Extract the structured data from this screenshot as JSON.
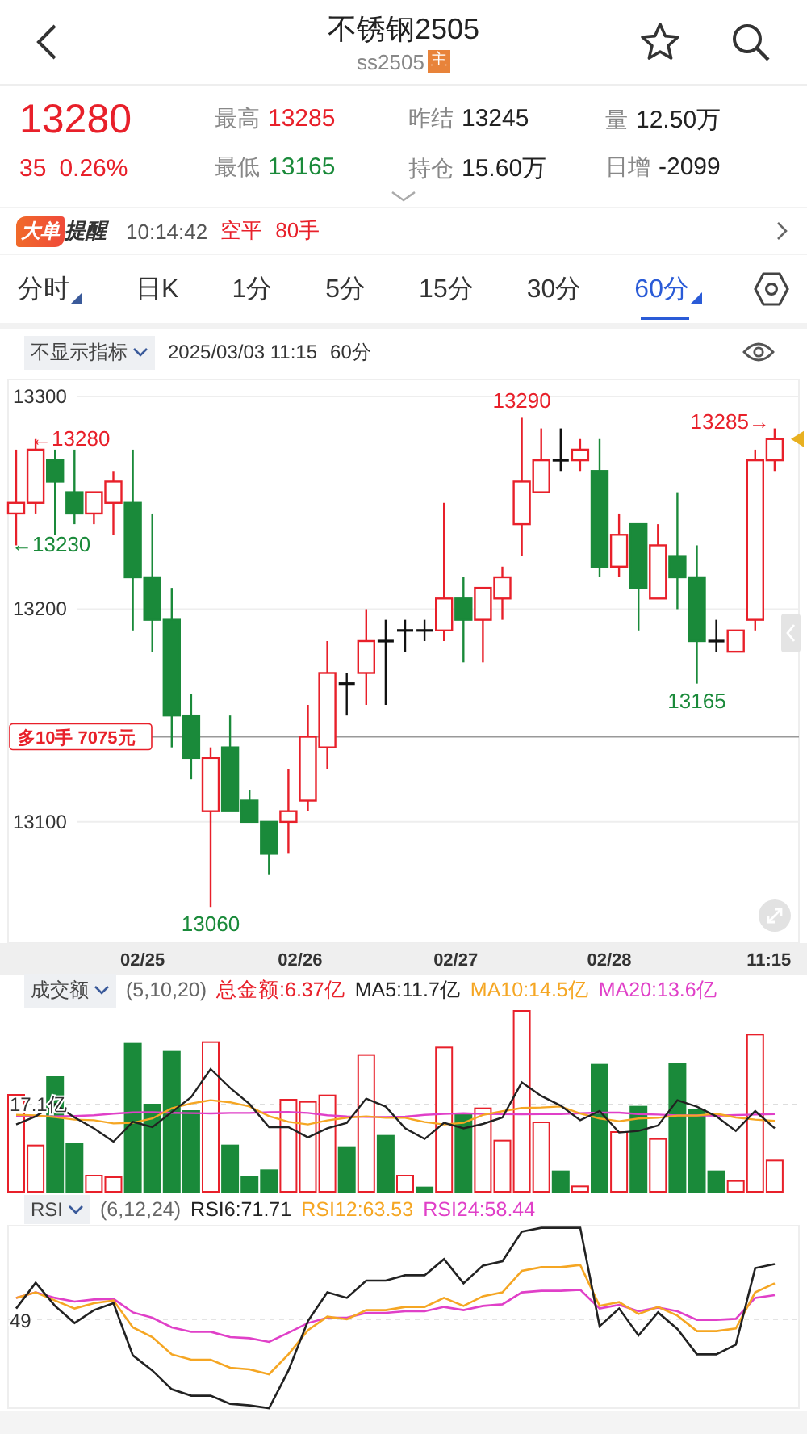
{
  "header": {
    "title": "不锈钢2505",
    "code": "ss2505",
    "badge": "主"
  },
  "quote": {
    "price": "13280",
    "change": "35",
    "change_pct": "0.26%",
    "stats": [
      {
        "label": "最高",
        "value": "13285",
        "color": "#e8202a"
      },
      {
        "label": "昨结",
        "value": "13245",
        "color": "#222222"
      },
      {
        "label": "量",
        "value": "12.50万",
        "color": "#222222"
      },
      {
        "label": "最低",
        "value": "13165",
        "color": "#1a8a3a"
      },
      {
        "label": "持仓",
        "value": "15.60万",
        "color": "#222222"
      },
      {
        "label": "日增",
        "value": "-2099",
        "color": "#222222"
      }
    ]
  },
  "alert": {
    "tag": "大单",
    "title": "提醒",
    "time": "10:14:42",
    "action": "空平",
    "size": "80手"
  },
  "periods": [
    {
      "label": "分时",
      "selected": false,
      "menu": true
    },
    {
      "label": "日K",
      "selected": false,
      "menu": false
    },
    {
      "label": "1分",
      "selected": false,
      "menu": false
    },
    {
      "label": "5分",
      "selected": false,
      "menu": false
    },
    {
      "label": "15分",
      "selected": false,
      "menu": false
    },
    {
      "label": "30分",
      "selected": false,
      "menu": false
    },
    {
      "label": "60分",
      "selected": true,
      "menu": true
    }
  ],
  "indicator_bar": {
    "selector": "不显示指标",
    "date": "2025/03/03 11:15",
    "period": "60分"
  },
  "kline": {
    "price_axis": [
      "13300",
      "13200",
      "13100"
    ],
    "time_axis": [
      "02/25",
      "02/26",
      "02/27",
      "02/28",
      "11:15"
    ],
    "marks": [
      {
        "text": "←13280",
        "kind": "high"
      },
      {
        "text": "←13230",
        "kind": "low"
      },
      {
        "text": "13060",
        "kind": "low"
      },
      {
        "text": "13290",
        "kind": "high"
      },
      {
        "text": "13165",
        "kind": "low"
      },
      {
        "text": "13285→",
        "kind": "high"
      }
    ],
    "position_tag": "多10手 7075元"
  },
  "volume": {
    "selector": "成交额",
    "params": "(5,10,20)",
    "axis_label": "17.1亿",
    "readings": [
      {
        "text": "总金额:6.37亿",
        "color": "#e8202a"
      },
      {
        "text": "MA5:11.7亿",
        "color": "#222222"
      },
      {
        "text": "MA10:14.5亿",
        "color": "#f5a623"
      },
      {
        "text": "MA20:13.6亿",
        "color": "#e040c8"
      }
    ]
  },
  "rsi": {
    "selector": "RSI",
    "params": "(6,12,24)",
    "axis_label": "49",
    "readings": [
      {
        "text": "RSI6:71.71",
        "color": "#222222"
      },
      {
        "text": "RSI12:63.53",
        "color": "#f5a623"
      },
      {
        "text": "RSI24:58.44",
        "color": "#e040c8"
      }
    ]
  }
}
